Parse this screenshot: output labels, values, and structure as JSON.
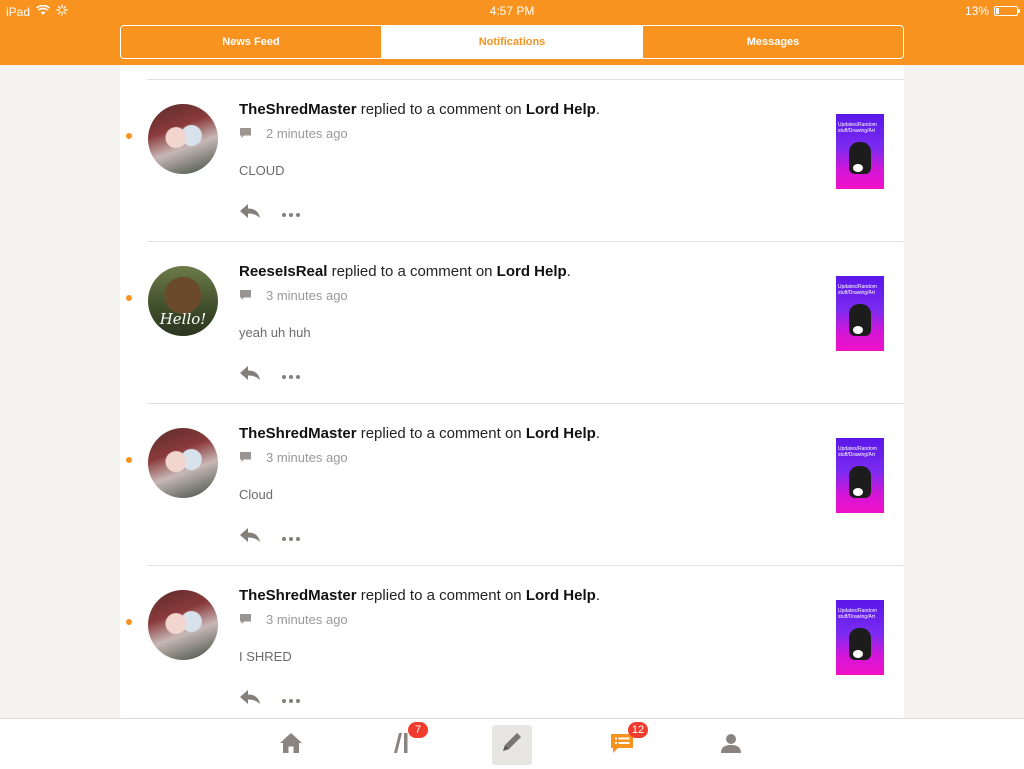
{
  "status_bar": {
    "device": "iPad",
    "time": "4:57 PM",
    "battery": "13%",
    "battery_level": 0.13
  },
  "tabs": [
    {
      "label": "News Feed",
      "active": false
    },
    {
      "label": "Notifications",
      "active": true
    },
    {
      "label": "Messages",
      "active": false
    }
  ],
  "notifications": [
    {
      "user": "TheShredMaster",
      "action": "replied to a comment on",
      "story": "Lord Help",
      "time": "2 minutes ago",
      "text": "CLOUD",
      "avatar": "anime-avatar",
      "unread": true,
      "thumb_text_1": "Updates/Random",
      "thumb_text_2": "stuff/Drawing/Art"
    },
    {
      "user": "ReeseIsReal",
      "action": "replied to a comment on",
      "story": "Lord Help",
      "time": "3 minutes ago",
      "text": "yeah uh huh",
      "avatar": "bear-avatar",
      "avatar_caption": "Hello!",
      "unread": true,
      "thumb_text_1": "Updates/Random",
      "thumb_text_2": "stuff/Drawing/Art"
    },
    {
      "user": "TheShredMaster",
      "action": "replied to a comment on",
      "story": "Lord Help",
      "time": "3 minutes ago",
      "text": "Cloud",
      "avatar": "anime-avatar",
      "unread": true,
      "thumb_text_1": "Updates/Random",
      "thumb_text_2": "stuff/Drawing/Art"
    },
    {
      "user": "TheShredMaster",
      "action": "replied to a comment on",
      "story": "Lord Help",
      "time": "3 minutes ago",
      "text": "I SHRED",
      "avatar": "anime-avatar",
      "unread": true,
      "thumb_text_1": "Updates/Random",
      "thumb_text_2": "stuff/Drawing/Art"
    }
  ],
  "bottom_bar": {
    "library_badge": "7",
    "notifications_badge": "12"
  },
  "colors": {
    "accent": "#f7931e",
    "badge": "#f03c2e"
  }
}
